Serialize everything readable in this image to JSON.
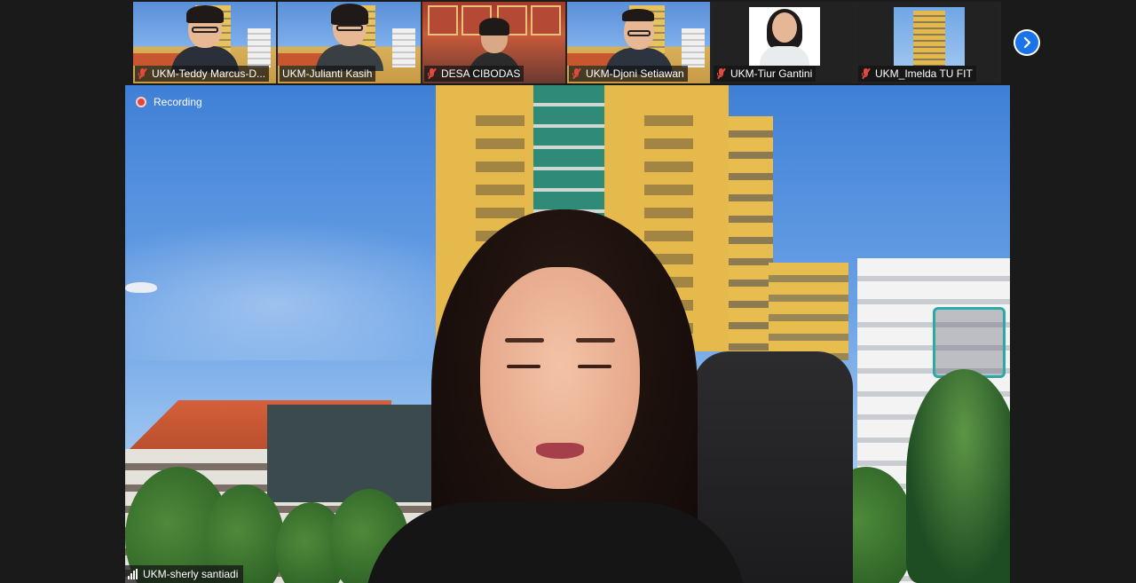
{
  "participants": [
    {
      "name": "UKM-Teddy Marcus-D...",
      "muted": true,
      "video": "campus"
    },
    {
      "name": "UKM-Julianti Kasih",
      "muted": false,
      "video": "campus"
    },
    {
      "name": "DESA CIBODAS",
      "muted": true,
      "video": "room"
    },
    {
      "name": "UKM-Djoni Setiawan",
      "muted": true,
      "video": "campus"
    },
    {
      "name": "UKM-Tiur Gantini",
      "muted": true,
      "video": "photo"
    },
    {
      "name": "UKM_Imelda TU FIT",
      "muted": true,
      "video": "building"
    }
  ],
  "next_page_icon": "chevron-right-icon",
  "main": {
    "recording_label": "Recording",
    "speaker_name": "UKM-sherly santiadi"
  },
  "colors": {
    "accent": "#1a73e8",
    "muted_icon": "#e04a3f",
    "recording": "#e2453a"
  }
}
